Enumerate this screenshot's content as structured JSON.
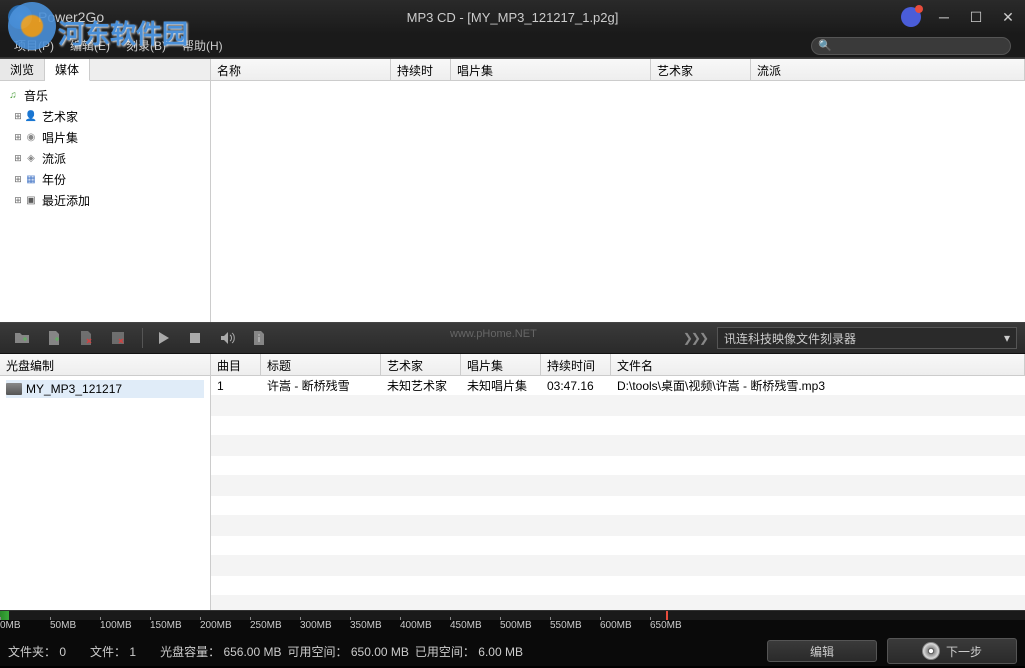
{
  "titlebar": {
    "app_name": "Power2Go",
    "title": "MP3 CD - [MY_MP3_121217_1.p2g]"
  },
  "watermark": {
    "text": "河东软件园",
    "url": "www.pHome.NET"
  },
  "menu": {
    "project": "项目(P)",
    "edit": "编辑(E)",
    "burn": "刻录(B)",
    "help": "帮助(H)"
  },
  "tabs": {
    "browse": "浏览",
    "media": "媒体"
  },
  "tree": {
    "music": "音乐",
    "artist": "艺术家",
    "album": "唱片集",
    "genre": "流派",
    "year": "年份",
    "recent": "最近添加"
  },
  "upper_cols": {
    "name": "名称",
    "duration": "持续时间",
    "album": "唱片集",
    "artist": "艺术家",
    "genre": "流派"
  },
  "toolbar": {
    "drive": "讯连科技映像文件刻录器"
  },
  "disc_panel": {
    "header": "光盘编制",
    "project": "MY_MP3_121217"
  },
  "track_cols": {
    "track": "曲目",
    "title": "标题",
    "artist": "艺术家",
    "album": "唱片集",
    "duration": "持续时间",
    "filename": "文件名"
  },
  "tracks": [
    {
      "num": "1",
      "title": "许嵩 - 断桥残雪",
      "artist": "未知艺术家",
      "album": "未知唱片集",
      "duration": "03:47.16",
      "filename": "D:\\tools\\桌面\\视频\\许嵩 - 断桥残雪.mp3"
    }
  ],
  "ruler": [
    "0MB",
    "50MB",
    "100MB",
    "150MB",
    "200MB",
    "250MB",
    "300MB",
    "350MB",
    "400MB",
    "450MB",
    "500MB",
    "550MB",
    "600MB",
    "650MB"
  ],
  "status": {
    "folders_label": "文件夹：",
    "folders": "0",
    "files_label": "文件：",
    "files": "1",
    "capacity_label": "光盘容量：",
    "capacity": "656.00 MB",
    "free_label": "可用空间：",
    "free": "650.00 MB",
    "used_label": "已用空间：",
    "used": "6.00 MB",
    "edit": "编辑",
    "next": "下一步"
  }
}
